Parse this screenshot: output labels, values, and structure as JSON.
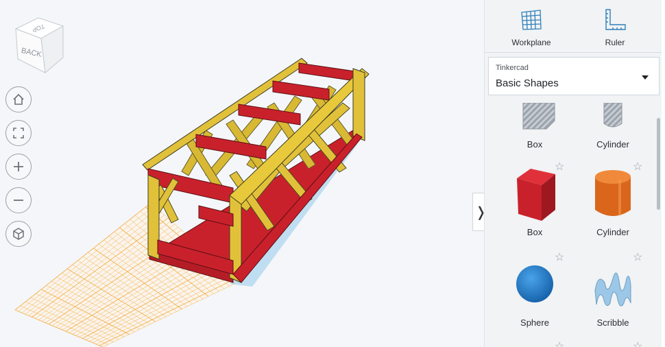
{
  "toolbar": {
    "workplane_label": "Workplane",
    "ruler_label": "Ruler"
  },
  "library": {
    "provider": "Tinkercad",
    "category": "Basic Shapes"
  },
  "shapes": [
    {
      "name": "Box",
      "style": "hole"
    },
    {
      "name": "Cylinder",
      "style": "hole"
    },
    {
      "name": "Box",
      "color": "#c9212b"
    },
    {
      "name": "Cylinder",
      "color": "#e8741f"
    },
    {
      "name": "Sphere",
      "color": "#1e7fd3"
    },
    {
      "name": "Scribble",
      "color": "#9cc7e6"
    }
  ],
  "viewcube": {
    "face_front": "BACK",
    "face_top": "TOP"
  },
  "nav_buttons": [
    "home-icon",
    "fit-view-icon",
    "zoom-in-icon",
    "zoom-out-icon",
    "ortho-view-icon"
  ],
  "colors": {
    "beam_yellow": "#e2c13a",
    "beam_red": "#c9212b",
    "grid_orange": "#f5b04a",
    "panel_bg": "#f1f3f5",
    "workplane_blue": "#2d7fb8"
  }
}
